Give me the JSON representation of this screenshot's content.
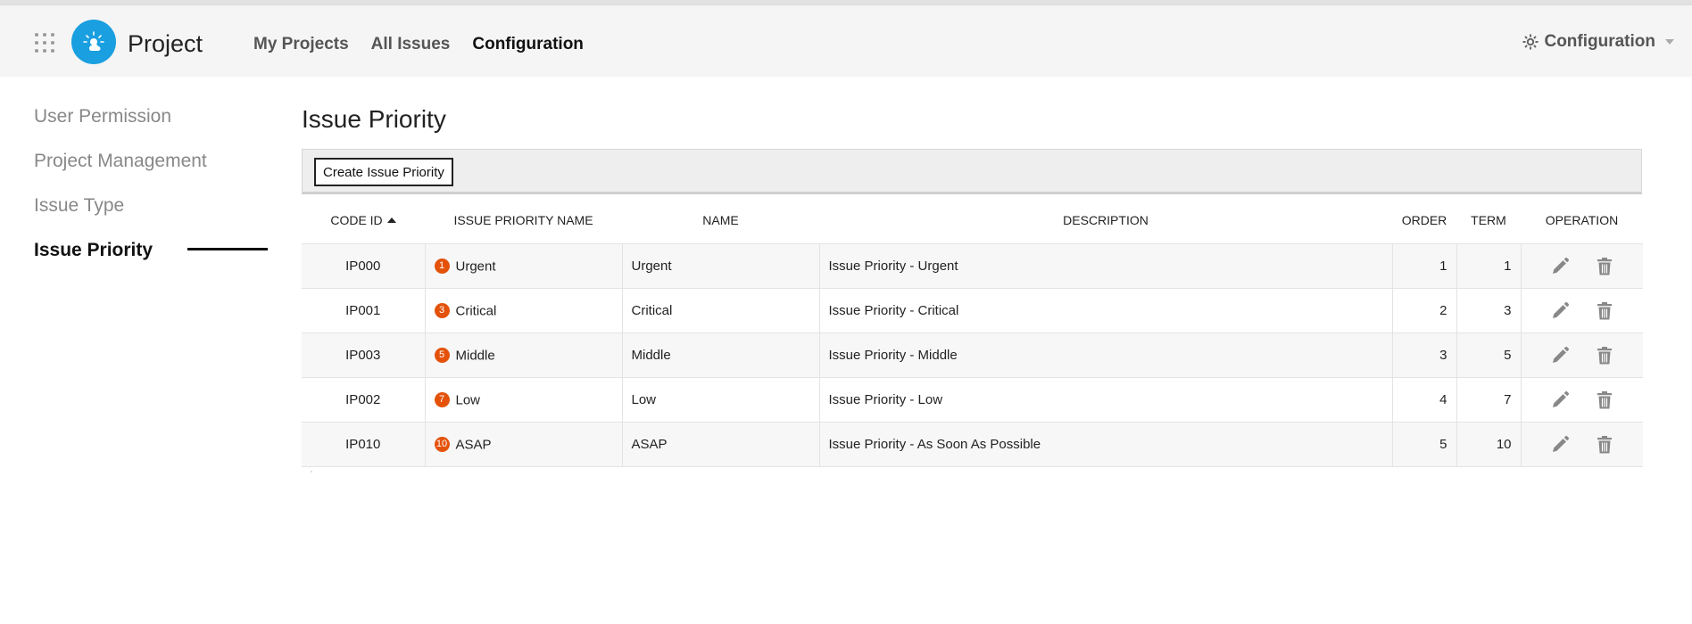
{
  "header": {
    "app_title": "Project",
    "nav": [
      {
        "label": "My Projects"
      },
      {
        "label": "All Issues"
      },
      {
        "label": "Configuration"
      }
    ],
    "config_menu_label": "Configuration",
    "icons": {
      "apps": "apps-grid-icon",
      "logo": "cloud-sun-logo",
      "settings": "gear-icon"
    },
    "accent_color": "#1a9fe0"
  },
  "sidebar": {
    "items": [
      {
        "label": "User Permission"
      },
      {
        "label": "Project Management"
      },
      {
        "label": "Issue Type"
      },
      {
        "label": "Issue Priority"
      }
    ],
    "active": "Issue Priority"
  },
  "main": {
    "title": "Issue Priority",
    "create_button": "Create Issue Priority",
    "columns": [
      "CODE ID",
      "ISSUE PRIORITY NAME",
      "NAME",
      "DESCRIPTION",
      "ORDER",
      "TERM",
      "OPERATION"
    ],
    "sort": {
      "column": "CODE ID",
      "direction": "asc"
    },
    "rows": [
      {
        "code": "IP000",
        "badge": "1",
        "priority_name": "Urgent",
        "name": "Urgent",
        "description": "Issue Priority - Urgent",
        "order": "1",
        "term": "1"
      },
      {
        "code": "IP001",
        "badge": "3",
        "priority_name": "Critical",
        "name": "Critical",
        "description": "Issue Priority - Critical",
        "order": "2",
        "term": "3"
      },
      {
        "code": "IP003",
        "badge": "5",
        "priority_name": "Middle",
        "name": "Middle",
        "description": "Issue Priority - Middle",
        "order": "3",
        "term": "5"
      },
      {
        "code": "IP002",
        "badge": "7",
        "priority_name": "Low",
        "name": "Low",
        "description": "Issue Priority - Low",
        "order": "4",
        "term": "7"
      },
      {
        "code": "IP010",
        "badge": "10",
        "priority_name": "ASAP",
        "name": "ASAP",
        "description": "Issue Priority - As Soon As Possible",
        "order": "5",
        "term": "10"
      }
    ],
    "badge_color": "#e4520a",
    "row_icons": {
      "edit": "pencil-icon",
      "delete": "trash-icon"
    }
  }
}
